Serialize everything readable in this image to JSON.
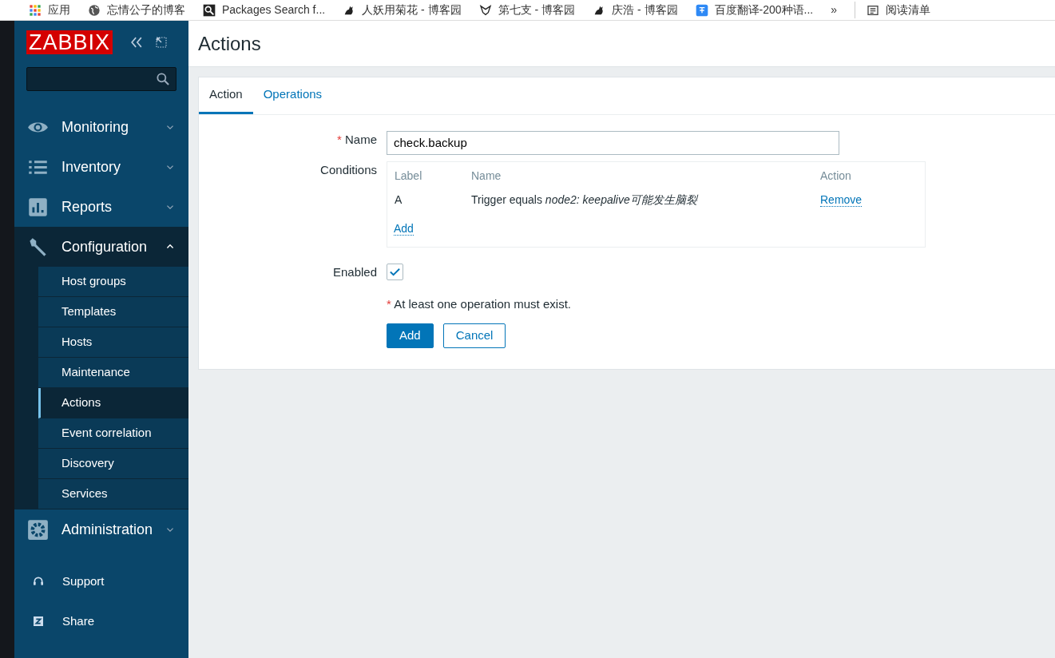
{
  "bookmarks": [
    {
      "kind": "apps",
      "label": "应用"
    },
    {
      "kind": "globe",
      "label": "忘情公子的博客"
    },
    {
      "kind": "search",
      "label": "Packages Search f..."
    },
    {
      "kind": "cat",
      "label": "人妖用菊花 - 博客园"
    },
    {
      "kind": "bird",
      "label": "第七支 - 博客园"
    },
    {
      "kind": "cat",
      "label": "庆浩 - 博客园"
    },
    {
      "kind": "translate",
      "label": "百度翻译-200种语..."
    }
  ],
  "bookmarks_more": "»",
  "reading_list": "阅读清单",
  "sidebar": {
    "logo": "ZABBIX",
    "menu": [
      {
        "kind": "eye",
        "label": "Monitoring",
        "expanded": false
      },
      {
        "kind": "list",
        "label": "Inventory",
        "expanded": false
      },
      {
        "kind": "chart",
        "label": "Reports",
        "expanded": false
      },
      {
        "kind": "wrench",
        "label": "Configuration",
        "expanded": true,
        "children": [
          {
            "label": "Host groups",
            "selected": false
          },
          {
            "label": "Templates",
            "selected": false
          },
          {
            "label": "Hosts",
            "selected": false
          },
          {
            "label": "Maintenance",
            "selected": false
          },
          {
            "label": "Actions",
            "selected": true
          },
          {
            "label": "Event correlation",
            "selected": false
          },
          {
            "label": "Discovery",
            "selected": false
          },
          {
            "label": "Services",
            "selected": false
          }
        ]
      },
      {
        "kind": "gear",
        "label": "Administration",
        "expanded": false
      }
    ],
    "links": [
      {
        "kind": "headset",
        "label": "Support"
      },
      {
        "kind": "z",
        "label": "Share"
      }
    ]
  },
  "page_title": "Actions",
  "tabs": [
    {
      "label": "Action",
      "selected": true
    },
    {
      "label": "Operations",
      "selected": false
    }
  ],
  "form": {
    "required_mark": "*",
    "name_label": "Name",
    "name_value": "check.backup",
    "conditions_label": "Conditions",
    "conditions": {
      "columns": [
        "Label",
        "Name",
        "Action"
      ],
      "rows": [
        {
          "label": "A",
          "name": "Trigger equals *node2: keepalive可能发生脑裂*",
          "action": "Remove"
        }
      ],
      "add": "Add"
    },
    "enabled_label": "Enabled",
    "enabled": true,
    "warning": "At least one operation must exist.",
    "buttons": [
      {
        "kind": "primary",
        "label": "Add"
      },
      {
        "kind": "secondary",
        "label": "Cancel"
      }
    ]
  }
}
